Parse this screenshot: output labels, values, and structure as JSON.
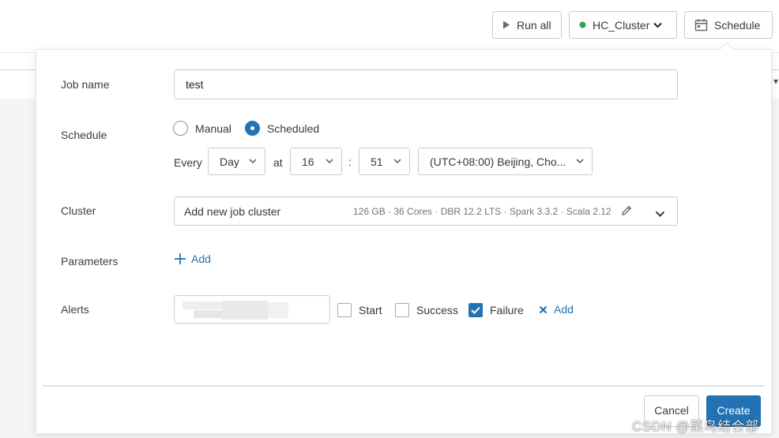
{
  "toolbar": {
    "run_all_label": "Run all",
    "cluster_label": "HC_Cluster",
    "cluster_status_color": "#2ea44f",
    "schedule_label": "Schedule"
  },
  "form": {
    "job_name": {
      "label": "Job name",
      "value": "test"
    },
    "schedule": {
      "label": "Schedule",
      "options": [
        "Manual",
        "Scheduled"
      ],
      "selected": "Scheduled",
      "every_label": "Every",
      "unit": "Day",
      "at_label": "at",
      "hour": "16",
      "colon": ":",
      "minute": "51",
      "timezone": "(UTC+08:00) Beijing, Cho..."
    },
    "cluster": {
      "label": "Cluster",
      "value": "Add new job cluster",
      "details": "126 GB · 36 Cores · DBR 12.2 LTS · Spark 3.3.2 · Scala 2.12"
    },
    "parameters": {
      "label": "Parameters",
      "add_label": "Add"
    },
    "alerts": {
      "label": "Alerts",
      "start_label": "Start",
      "success_label": "Success",
      "failure_label": "Failure",
      "failure_checked": true,
      "add_label": "Add"
    }
  },
  "footer": {
    "cancel_label": "Cancel",
    "create_label": "Create"
  },
  "watermark": "CSDN @菜鸟结合部",
  "colors": {
    "accent": "#2272b4"
  }
}
